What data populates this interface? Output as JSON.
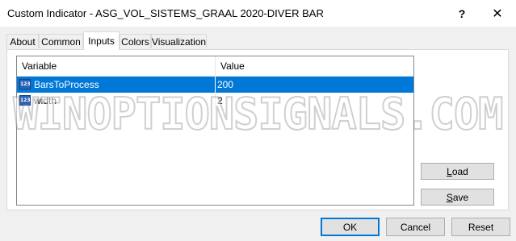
{
  "window": {
    "title": "Custom Indicator - ASG_VOL_SISTEMS_GRAAL 2020-DIVER BAR",
    "help_glyph": "?",
    "close_glyph": "✕"
  },
  "tabs": [
    {
      "label": "About"
    },
    {
      "label": "Common"
    },
    {
      "label": "Inputs",
      "active": true
    },
    {
      "label": "Colors"
    },
    {
      "label": "Visualization"
    }
  ],
  "grid": {
    "columns": {
      "variable": "Variable",
      "value": "Value"
    },
    "rows": [
      {
        "icon": "numeric-input-icon",
        "icon_text": "123",
        "name": "BarsToProcess",
        "value": "200",
        "selected": true
      },
      {
        "icon": "numeric-input-icon",
        "icon_text": "123",
        "name": "width",
        "value": "2",
        "selected": false
      }
    ]
  },
  "side_buttons": {
    "load": {
      "accel": "L",
      "rest": "oad"
    },
    "save": {
      "accel": "S",
      "rest": "ave"
    }
  },
  "buttons": {
    "ok": "OK",
    "cancel": "Cancel",
    "reset": "Reset"
  },
  "watermark": "WINOPTIONSIGNALS.COM",
  "colors": {
    "selection": "#0078d7",
    "default_button_border": "#0078d7"
  }
}
